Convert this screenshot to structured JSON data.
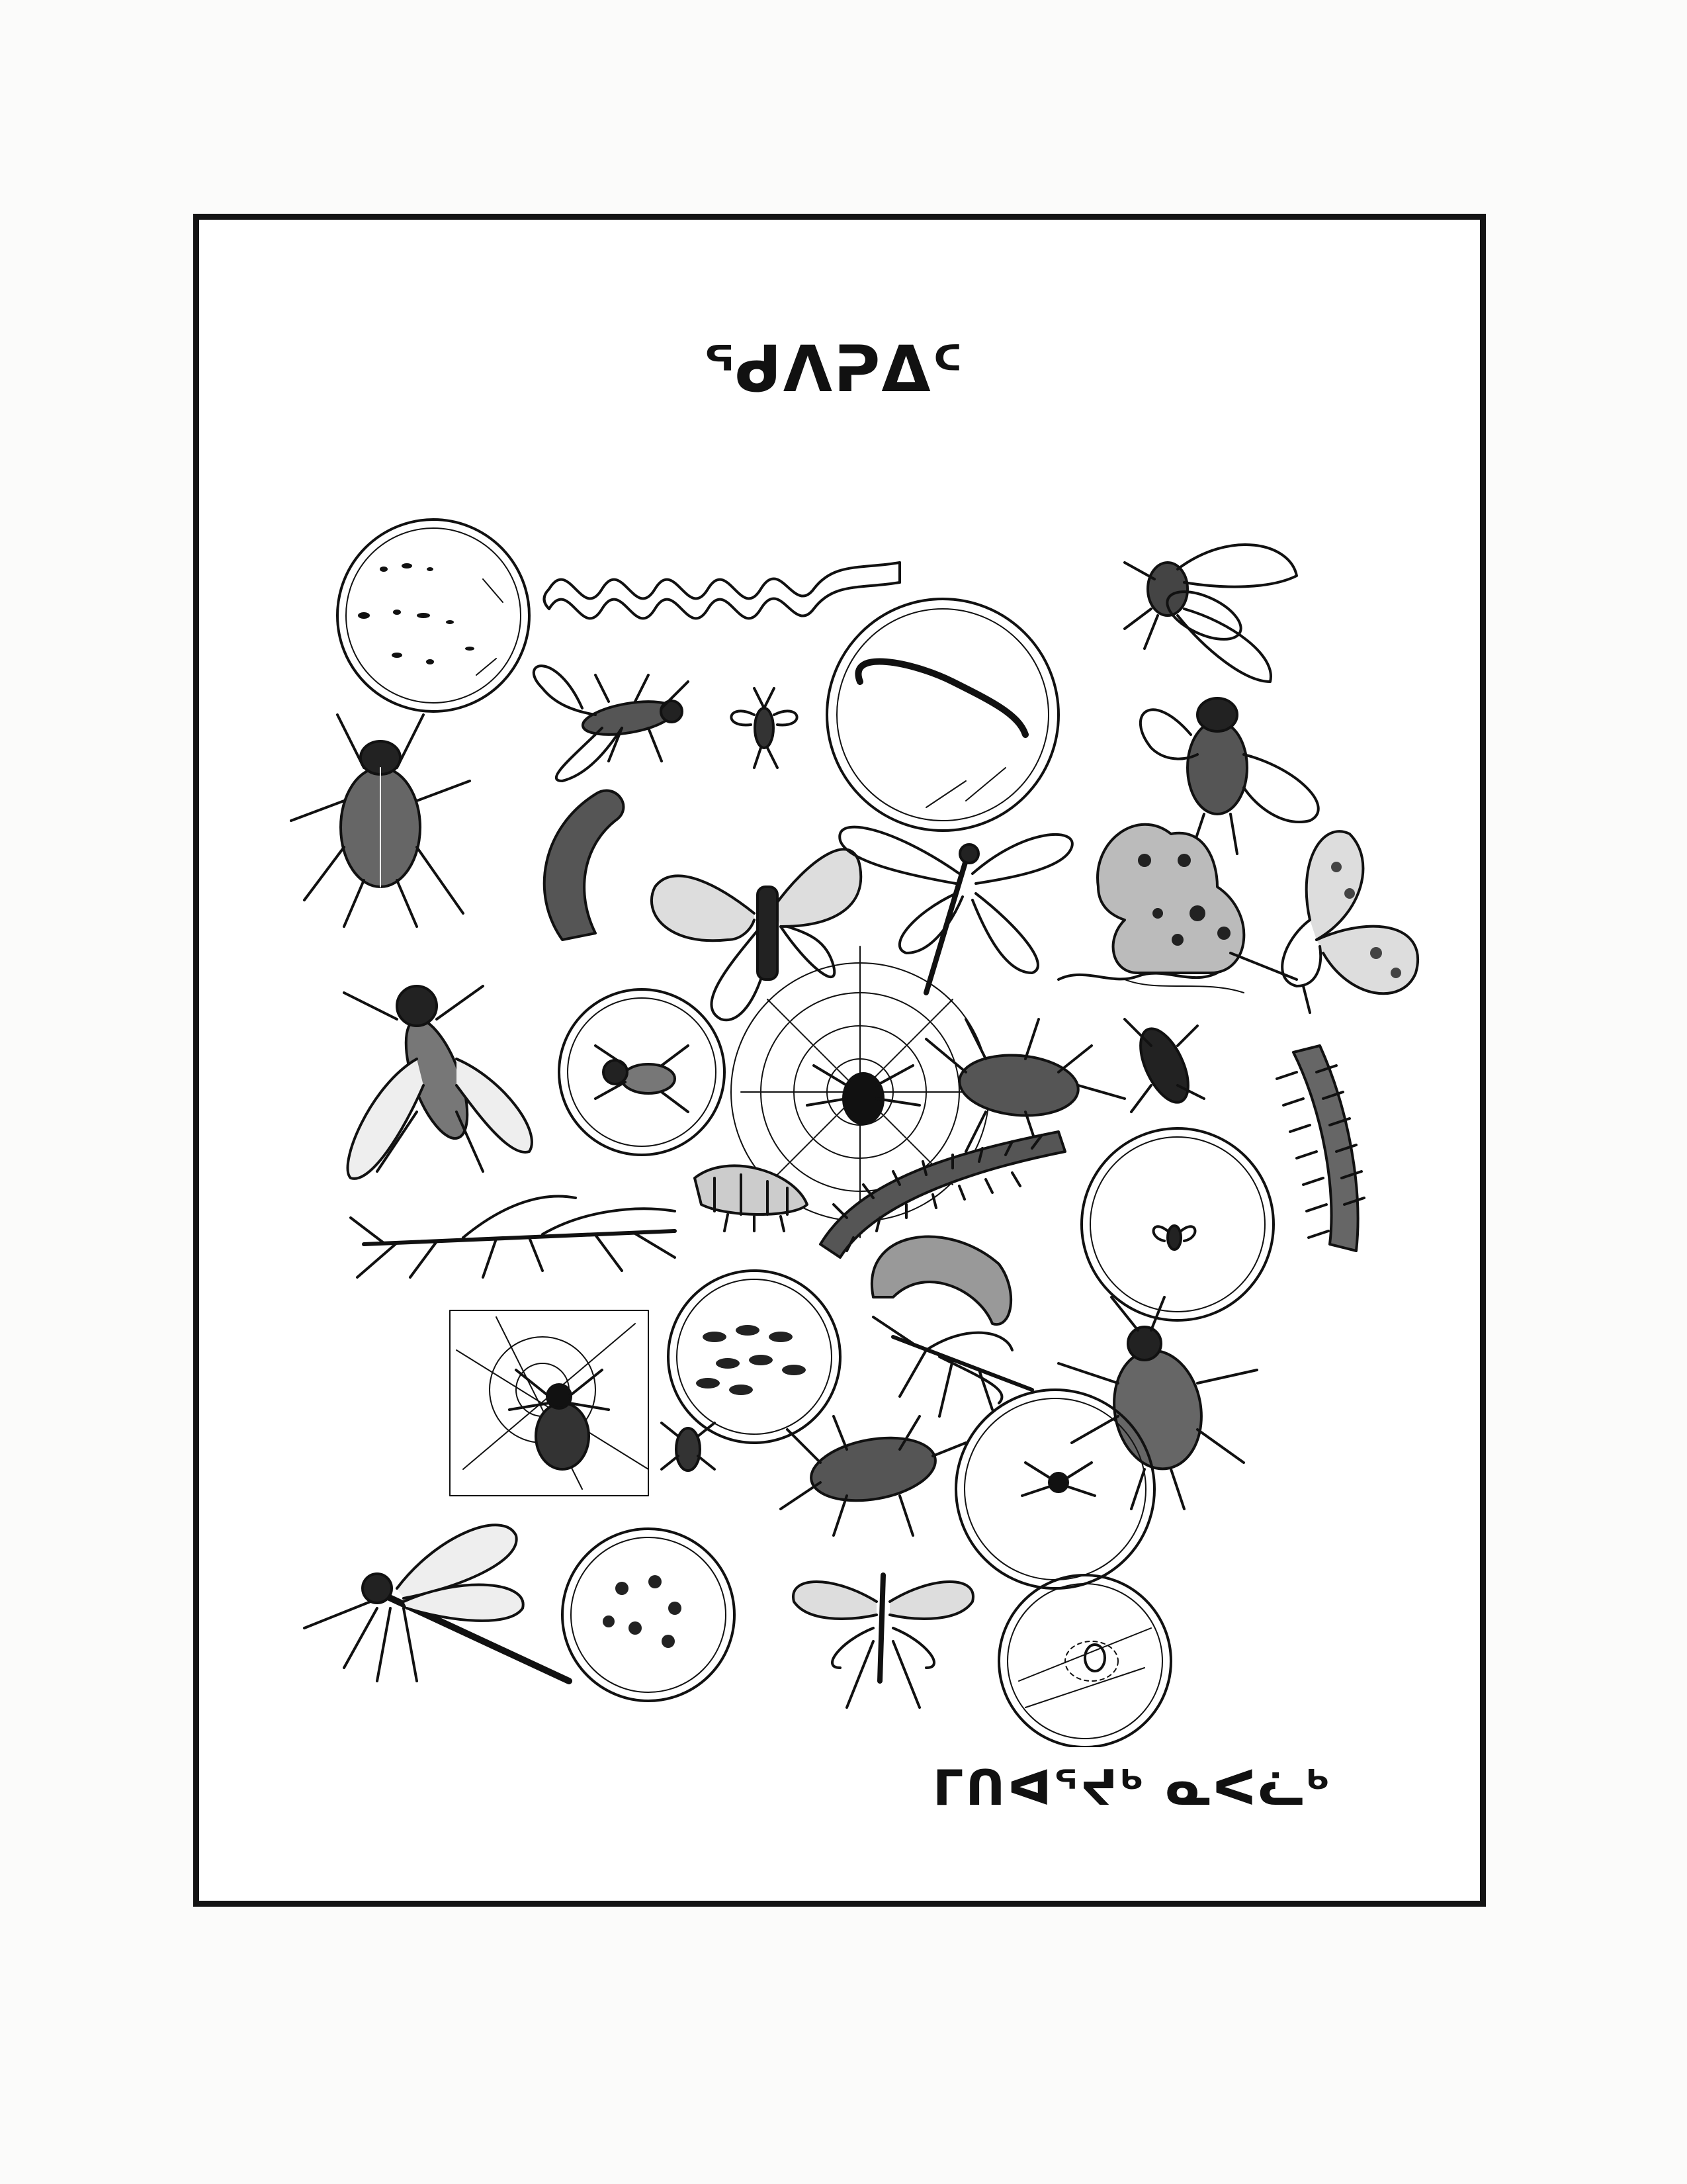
{
  "page": {
    "title": "ᖁᐱᕈᐃᑦ",
    "credit": "ᒥᑎᐊᕐᔪᒃ ᓇᐸᓛᒃ"
  },
  "illustrations": [
    "microscope-circle-icon",
    "coiled-worm-icon",
    "housefly-icon",
    "earthworm-in-circle-icon",
    "winged-fly-icon",
    "small-wasp-icon",
    "bumblebee-icon",
    "beetle-icon",
    "hairy-caterpillar-icon",
    "moth-icon",
    "dragonfly-icon",
    "frog-icon",
    "butterfly-icon",
    "hoverfly-icon",
    "mite-in-circle-icon",
    "spider-on-web-icon",
    "cockroach-icon",
    "water-beetle-icon",
    "millipede-icon",
    "stick-insect-icon",
    "larva-icon",
    "centipede-icon",
    "grub-icon",
    "gnat-in-circle-icon",
    "spider-web-panel-icon",
    "eggs-in-circle-icon",
    "mosquito-icon",
    "ground-beetle-icon",
    "tick-icon",
    "water-bug-icon",
    "small-spider-in-circle-icon",
    "large-dragonfly-icon",
    "lice-in-circle-icon",
    "crane-fly-icon",
    "cell-in-circle-icon"
  ]
}
